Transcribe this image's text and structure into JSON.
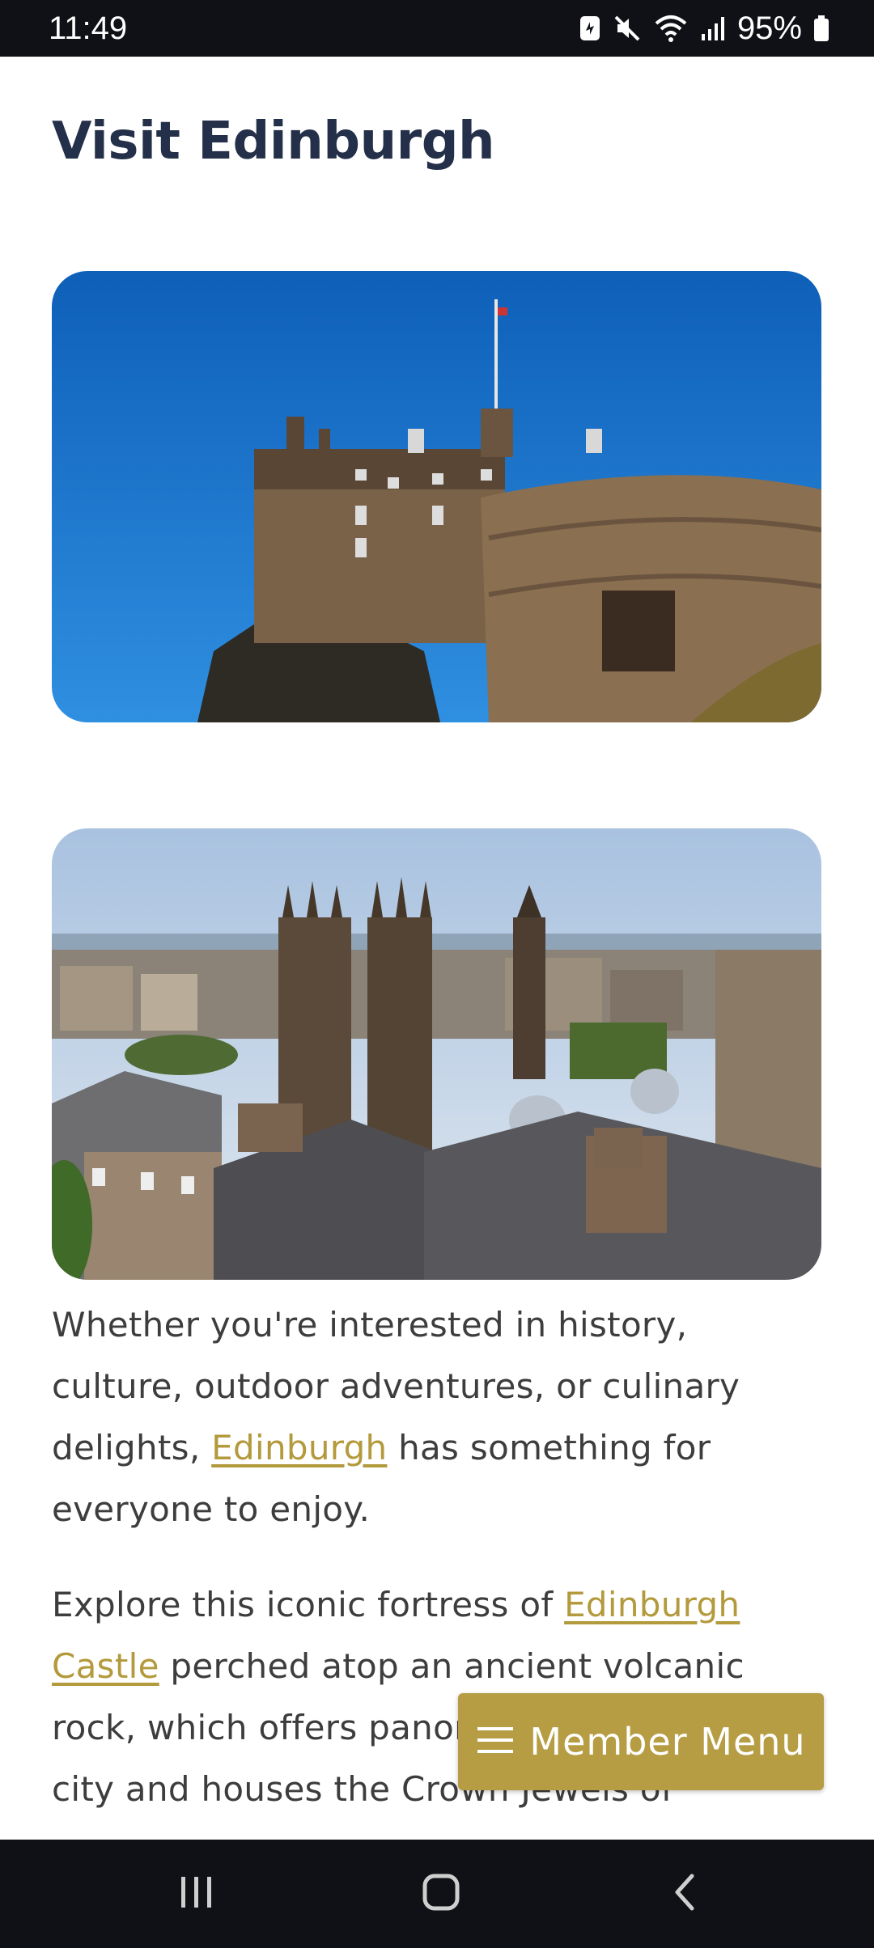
{
  "status_bar": {
    "time": "11:49",
    "battery_percent": "95%",
    "icons": [
      "sync-icon",
      "mute-icon",
      "wifi-icon",
      "signal-icon",
      "battery-icon"
    ]
  },
  "page": {
    "title": "Visit Edinburgh",
    "images": [
      {
        "name": "edinburgh-castle-photo",
        "icon": "castle-on-rock"
      },
      {
        "name": "old-town-skyline-photo",
        "icon": "city-rooftops"
      }
    ],
    "paragraph_1": {
      "before": "Whether you're interested in history, culture, outdoor adventures, or culinary delights, ",
      "link": "Edinburgh",
      "after": " has something for everyone to enjoy."
    },
    "paragraph_2": {
      "before": "Explore this iconic fortress of ",
      "link": "Edinburgh Castle",
      "after": " perched atop an ancient volcanic rock, which offers panoramic views of the city and houses the Crown Jewels of"
    }
  },
  "member_menu": {
    "label": "Member Menu",
    "icon": "hamburger-menu-icon"
  },
  "nav_bar": {
    "buttons": [
      "recent-apps-icon",
      "home-icon",
      "back-icon"
    ]
  },
  "colors": {
    "title": "#24304a",
    "link": "#b39a3c",
    "button": "#b69c43",
    "bars": "#0f1116",
    "text": "#3d3d3d"
  }
}
